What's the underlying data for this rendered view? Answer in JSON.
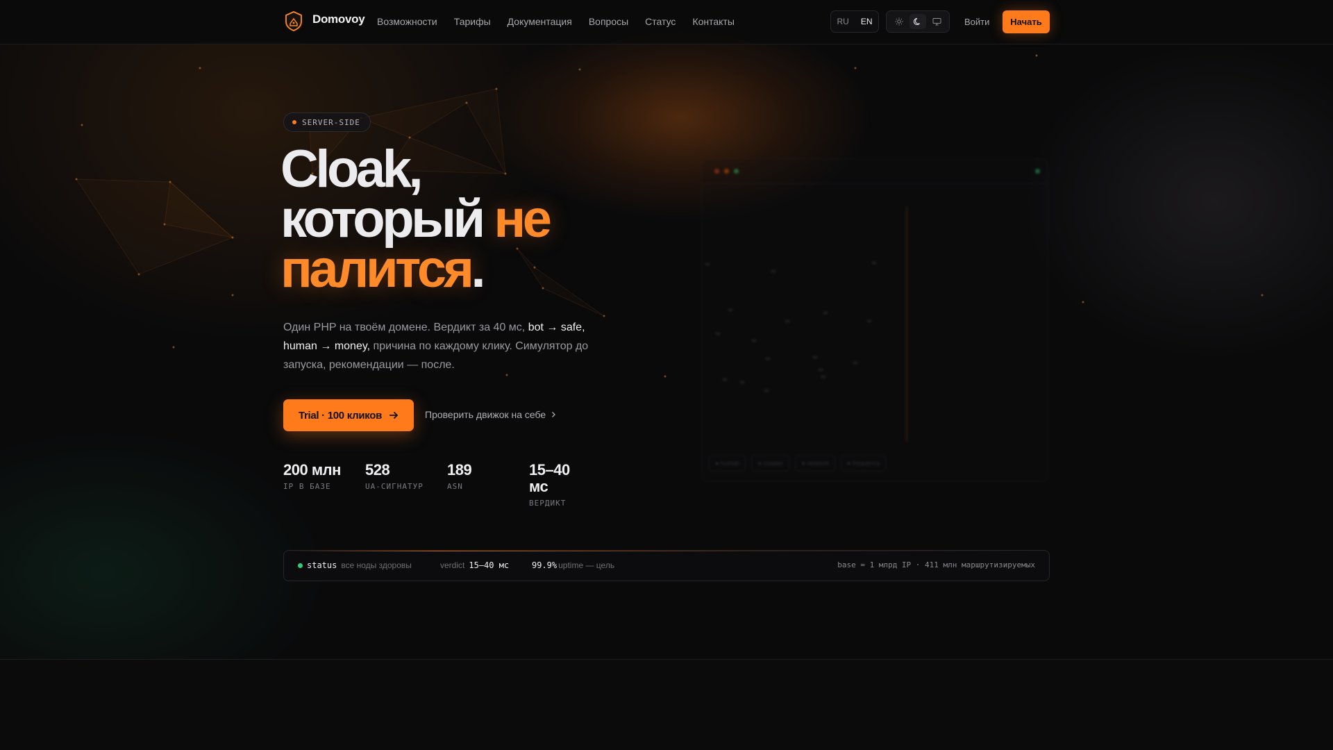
{
  "header": {
    "brand": "Domovoy",
    "nav": [
      "Возможности",
      "Тарифы",
      "Документация",
      "Вопросы",
      "Статус",
      "Контакты"
    ],
    "lang": {
      "options": [
        "RU",
        "EN"
      ],
      "active": "EN"
    },
    "theme": {
      "options": [
        "sun-icon",
        "moon-icon",
        "monitor-icon"
      ],
      "active": "moon-icon"
    },
    "login_label": "Войти",
    "start_label": "Начать"
  },
  "hero": {
    "badge": "SERVER-SIDE",
    "headline": {
      "line1": "Cloak,",
      "line2_white": "который",
      "line2_orange": "не",
      "line3_orange": "палится",
      "line3_white": "."
    },
    "subtitle": {
      "p1": "Один PHP на твоём домене. Вердикт за 40 мс,",
      "b1": "bot → safe,",
      "b2": "human → money,",
      "p2": "причина по каждому клику. Симулятор до запуска, рекомендации — после."
    },
    "cta_label": "Trial · 100 кликов",
    "secondary_label": "Проверить движок на себе",
    "stats": [
      {
        "value": "200 млн",
        "label": "IP В БАЗЕ"
      },
      {
        "value": "528",
        "label": "UA-СИГНАТУР"
      },
      {
        "value": "189",
        "label": "ASN"
      },
      {
        "value": "15–40 мс",
        "label": "ВЕРДИКТ"
      }
    ]
  },
  "statusbar": {
    "status_key": "status",
    "status_desc": "все ноды здоровы",
    "verdict_key": "verdict",
    "verdict_value": "15–40 мс",
    "uptime_value": "99.9%",
    "uptime_desc": "uptime — цель",
    "base_note": "base = 1 млрд IP · 411 млн маршрутизируемых"
  },
  "colors": {
    "accent": "#ff7a1a",
    "background": "#0a0a0b",
    "status_ok": "#2fcf7a"
  }
}
